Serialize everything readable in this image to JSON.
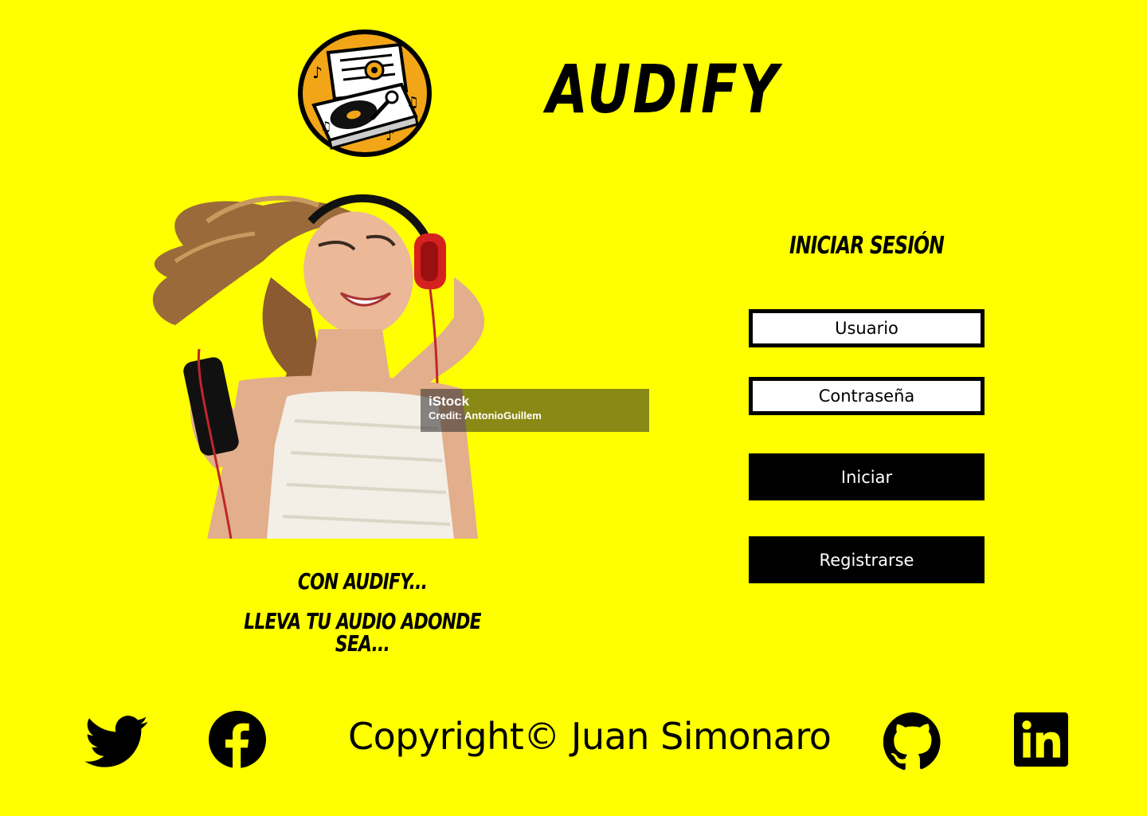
{
  "header": {
    "logo_icon": "vinyl-record-player-logo",
    "brand_name": "AUDIFY"
  },
  "hero": {
    "image": "woman-dancing-with-headphones-photo",
    "watermark_brand": "iStock",
    "watermark_credit": "Credit: AntonioGuillem"
  },
  "slogan": {
    "line1": "Con Audify...",
    "line2": "Lleva tu audio adonde sea..."
  },
  "login": {
    "title": "Iniciar Sesión",
    "username_placeholder": "Usuario",
    "password_placeholder": "Contraseña",
    "login_label": "Iniciar",
    "register_label": "Registrarse"
  },
  "footer": {
    "copyright": "Copyright© Juan Simonaro",
    "social_icons": [
      "twitter-icon",
      "facebook-icon",
      "github-icon",
      "linkedin-icon"
    ]
  },
  "colors": {
    "background": "#FFFF00",
    "text": "#000000",
    "button_bg": "#000000",
    "button_text": "#FFFFFF",
    "logo_accent": "#F2A516"
  }
}
